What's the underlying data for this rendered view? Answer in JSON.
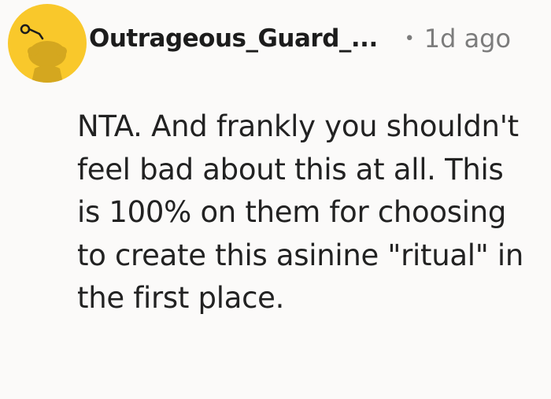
{
  "comment": {
    "username": "Outrageous_Guard_...",
    "separator": "•",
    "timestamp": "1d ago",
    "text": "NTA. And frankly you shouldn't feel bad about this at all. This is 100% on them for choosing to create this asinine \"ritual\" in the first place."
  },
  "colors": {
    "background": "#fbfaf9",
    "avatar_bg": "#f9c82b",
    "avatar_figure": "#d4a71f",
    "username": "#1c1c1c",
    "meta": "#7c7c7c",
    "body_text": "#222222"
  },
  "icons": {
    "avatar": "snoo-avatar-icon"
  }
}
